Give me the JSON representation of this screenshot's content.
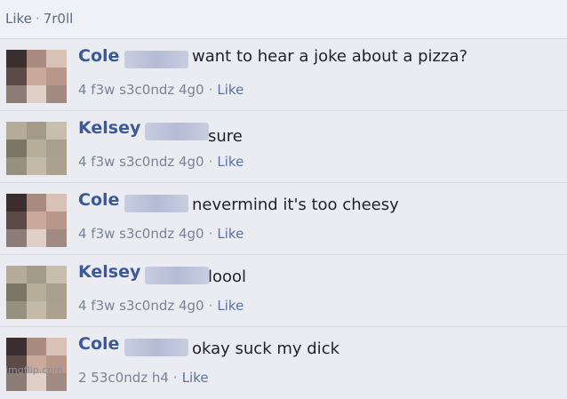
{
  "header": {
    "like": "Like",
    "time": "7r0ll"
  },
  "comments": [
    {
      "name": "Cole",
      "text": "want to hear a joke about a pizza?",
      "time": "4 f3w s3c0ndz 4g0",
      "like": "Like"
    },
    {
      "name": "Kelsey",
      "text": "sure",
      "time": "4 f3w s3c0ndz 4g0",
      "like": "Like"
    },
    {
      "name": "Cole",
      "text": "nevermind it's too cheesy",
      "time": "4 f3w s3c0ndz 4g0",
      "like": "Like"
    },
    {
      "name": "Kelsey",
      "text": "loool",
      "time": "4 f3w s3c0ndz 4g0",
      "like": "Like"
    },
    {
      "name": "Cole",
      "text": "okay suck my dick",
      "time": "2 53c0ndz h4",
      "like": "Like"
    }
  ],
  "watermark": "imgflip.com",
  "colors": {
    "name_link": "#3b5998",
    "meta_text": "#7b8294",
    "background": "#eaecf2"
  }
}
